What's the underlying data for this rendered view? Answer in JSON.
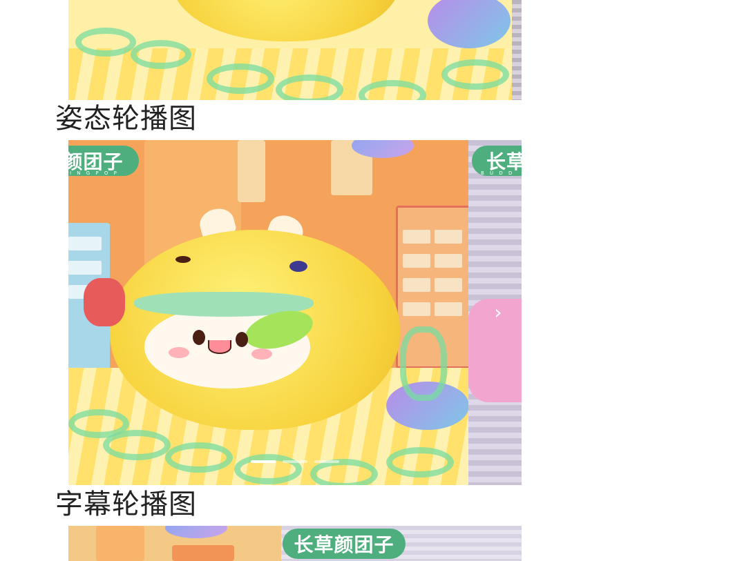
{
  "sections": {
    "pose_carousel_title": "姿态轮播图",
    "caption_carousel_title": "字幕轮播图"
  },
  "brand": {
    "name": "长草颜团子",
    "name_partial": "颜团子",
    "name_side": "长草",
    "sub": "BUDDING POP",
    "sub_partial": "I N G  P O P",
    "sub_side": "B U D D"
  },
  "carousel_main": {
    "slide_count": 3,
    "active_index": 0,
    "next_glyph": "›"
  },
  "colors": {
    "brand_green": "#4fae7d",
    "plush_yellow": "#f7d23c",
    "backdrop_orange": "#f5a25a",
    "stripe_yellow": "#ffe16b"
  }
}
